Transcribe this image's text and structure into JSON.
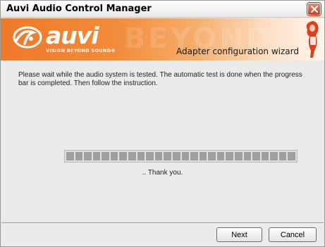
{
  "window": {
    "title": "Auvi Audio Control Manager",
    "close_icon": "close-icon"
  },
  "banner": {
    "brand": "auvi",
    "tagline": "VISION BEYOND SOUND®",
    "watermark": "BEYOND",
    "wizard_title": "Adapter configuration wizard",
    "accent_color": "#ee7a2a"
  },
  "content": {
    "instruction": "Please wait while the audio system is tested. The automatic test is done when the progress bar is completed. Then follow the instruction.",
    "status": ".. Thank you."
  },
  "footer": {
    "next_label": "Next",
    "cancel_label": "Cancel"
  }
}
